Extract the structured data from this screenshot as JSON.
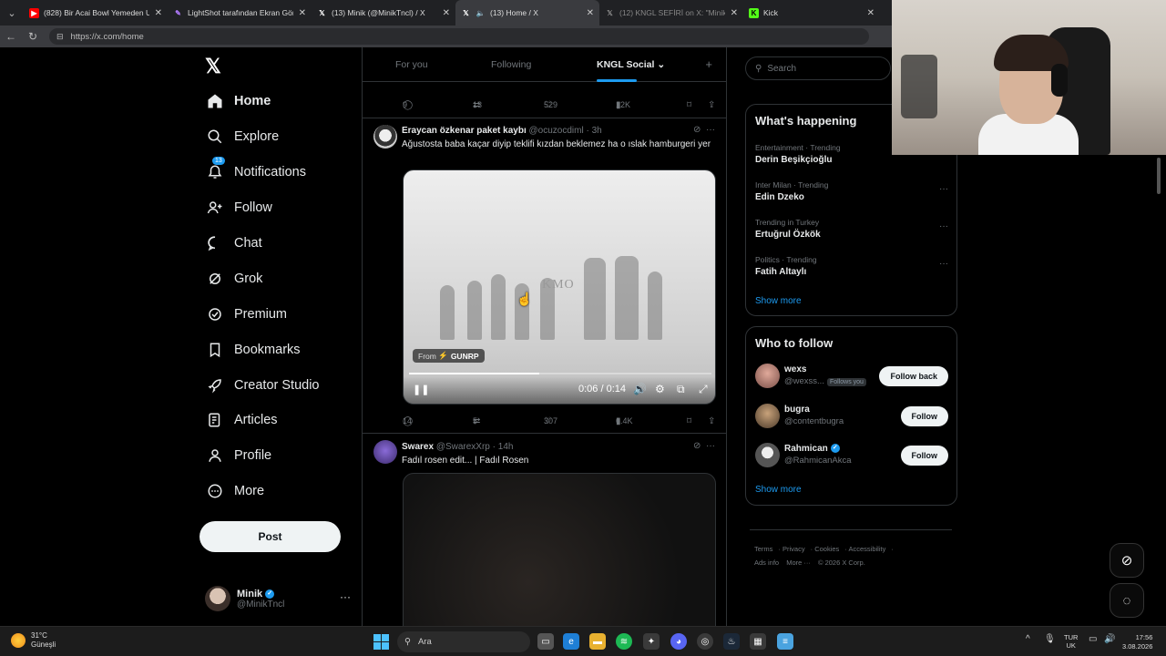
{
  "browser": {
    "tabs": [
      {
        "title": "(828) Bir Acai Bowl Yemeden Uyan",
        "icon_color": "#ff0000",
        "icon": "youtube-icon"
      },
      {
        "title": "LightShot tarafından Ekran Görün",
        "icon_color": "#9b59ff",
        "icon": "lightshot-icon"
      },
      {
        "title": "(13) Minik (@MinikTncl) / X",
        "icon_color": "#ffffff",
        "icon": "x-icon"
      },
      {
        "title": "(13) Home / X",
        "icon_color": "#ffffff",
        "icon": "x-icon",
        "active": true
      },
      {
        "title": "(12) KNGL SEFİRİ on X: \"Minik sik",
        "icon_color": "#888888",
        "icon": "x-icon"
      },
      {
        "title": "Kick",
        "icon_color": "#53fc18",
        "icon": "kick-icon"
      }
    ],
    "url": "https://x.com/home"
  },
  "nav": {
    "items": [
      {
        "label": "Home",
        "icon": "home-icon"
      },
      {
        "label": "Explore",
        "icon": "search-icon"
      },
      {
        "label": "Notifications",
        "icon": "bell-icon",
        "badge": "13"
      },
      {
        "label": "Follow",
        "icon": "add-person-icon"
      },
      {
        "label": "Chat",
        "icon": "chat-icon"
      },
      {
        "label": "Grok",
        "icon": "grok-icon"
      },
      {
        "label": "Premium",
        "icon": "premium-icon"
      },
      {
        "label": "Bookmarks",
        "icon": "bookmark-icon"
      },
      {
        "label": "Creator Studio",
        "icon": "rocket-icon"
      },
      {
        "label": "Articles",
        "icon": "article-icon"
      },
      {
        "label": "Profile",
        "icon": "person-icon"
      },
      {
        "label": "More",
        "icon": "more-icon"
      }
    ],
    "post_label": "Post",
    "profile": {
      "name": "Minik",
      "handle": "@MinikTncl"
    }
  },
  "feed": {
    "tabs": [
      "For you",
      "Following",
      "KNGL Social"
    ],
    "active_tab": "KNGL Social",
    "top_actions": {
      "replies": "9",
      "reposts": "13",
      "likes": "529",
      "views": "12K"
    },
    "tweets": [
      {
        "author": "Eraycan özkenar paket kaybı",
        "handle": "@ocuzocdiml",
        "time": "· 3h",
        "text": "Ağustosta baba kaçar diyip teklifi kızdan beklemez ha o ıslak hamburgeri yer",
        "video": {
          "watermark": "KMO",
          "from_label": "From",
          "from_source": "GUNRP",
          "time": "0:06 / 0:14",
          "progress": 0.43
        },
        "actions": {
          "replies": "14",
          "reposts": "5",
          "likes": "307",
          "views": "6.4K"
        }
      },
      {
        "author": "Swarex",
        "handle": "@SwarexXrp",
        "time": "· 14h",
        "text": "Fadıl rosen edit... | Fadıl Rosen"
      }
    ]
  },
  "right": {
    "search_placeholder": "Search",
    "happening_title": "What's happening",
    "trends": [
      {
        "category": "Entertainment · Trending",
        "name": "Derin Beşikçioğlu"
      },
      {
        "category": "Inter Milan · Trending",
        "name": "Edin Dzeko"
      },
      {
        "category": "Trending in Turkey",
        "name": "Ertuğrul Özkök"
      },
      {
        "category": "Politics · Trending",
        "name": "Fatih Altaylı"
      }
    ],
    "show_more": "Show more",
    "follow_title": "Who to follow",
    "follows": [
      {
        "name": "wexs",
        "handle": "@wexss...",
        "follows_you": "Follows you",
        "button": "Follow back"
      },
      {
        "name": "bugra",
        "handle": "@contentbugra",
        "button": "Follow"
      },
      {
        "name": "Rahmican",
        "handle": "@RahmicanAkca",
        "button": "Follow",
        "verified": true
      }
    ],
    "footer": [
      "Terms",
      "Privacy",
      "Cookies",
      "Accessibility",
      "Ads info",
      "More ···",
      "© 2026 X Corp."
    ]
  },
  "taskbar": {
    "temperature": "31°C",
    "weather": "Güneşli",
    "search": "Ara",
    "lang1": "TUR",
    "lang2": "UK",
    "time": "17:56",
    "date": "3.08.2026"
  },
  "colors": {
    "accent": "#1d9bf0",
    "bg": "#000000",
    "border": "#2f3336"
  }
}
